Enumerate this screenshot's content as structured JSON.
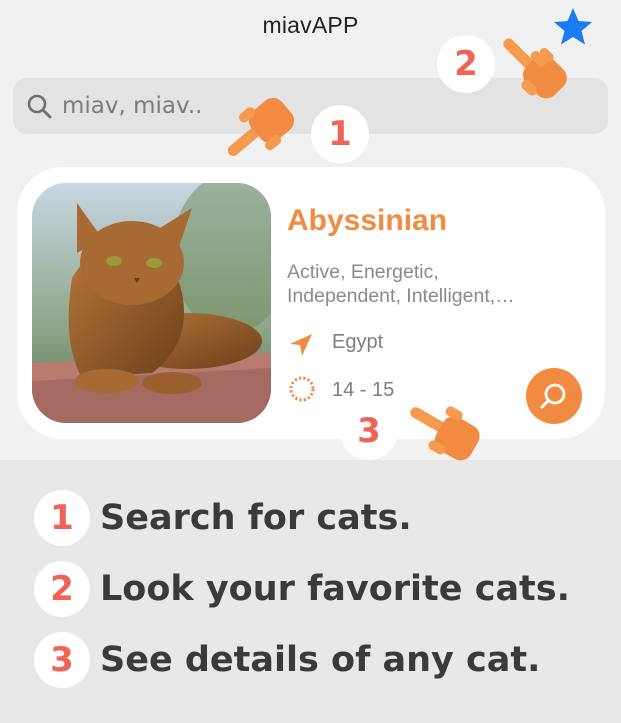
{
  "header": {
    "title": "miavAPP",
    "favorites_icon": "star-icon"
  },
  "search": {
    "placeholder": "miav, miav..",
    "icon": "search-icon"
  },
  "card": {
    "name": "Abyssinian",
    "temperament": "Active, Energetic, Independent, Intelligent,…",
    "origin": "Egypt",
    "life_span": "14 - 15",
    "image": "abyssinian-cat-photo",
    "detail_icon": "search-icon"
  },
  "callouts": {
    "one": "1",
    "two": "2",
    "three": "3"
  },
  "steps": [
    {
      "number": "1",
      "text": "Search for cats."
    },
    {
      "number": "2",
      "text": "Look your favorite cats."
    },
    {
      "number": "3",
      "text": "See details of any cat."
    }
  ],
  "colors": {
    "accent": "#f28b42",
    "star": "#1a7cf5",
    "badge_number": "#f06356",
    "background": "#f1f1f1"
  }
}
